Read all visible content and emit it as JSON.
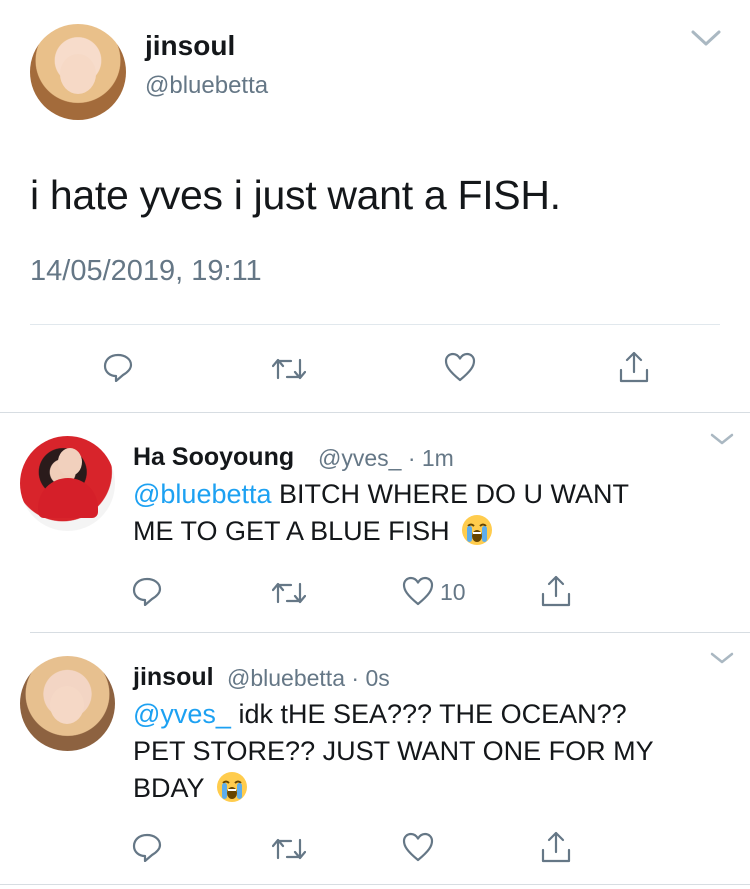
{
  "main_tweet": {
    "author_name": "jinsoul",
    "author_handle": "@bluebetta",
    "text": "i hate yves i just want a FISH.",
    "timestamp": "14/05/2019, 19:11",
    "actions": [
      "reply-icon",
      "retweet-icon",
      "like-icon",
      "share-icon"
    ]
  },
  "replies": [
    {
      "author_name": "Ha Sooyoung",
      "author_handle": "@yves_",
      "time": "1m",
      "separator": "·",
      "mention": "@bluebetta",
      "text_line1": " BITCH WHERE DO U WANT",
      "text_line2": "ME TO GET A BLUE FISH",
      "emoji": "loudly-crying-face",
      "like_count": "10"
    },
    {
      "author_name": "jinsoul",
      "author_handle": "@bluebetta",
      "time": "0s",
      "separator": "·",
      "mention": "@yves_",
      "text_line1": " idk tHE SEA??? THE OCEAN??",
      "text_line2": "PET STORE?? JUST WANT ONE FOR MY",
      "text_line3": "BDAY",
      "emoji": "loudly-crying-face"
    }
  ],
  "colors": {
    "link_blue": "#1da1f2",
    "secondary_gray": "#657786",
    "icon_gray": "#657786",
    "divider": "#d7dde2"
  }
}
